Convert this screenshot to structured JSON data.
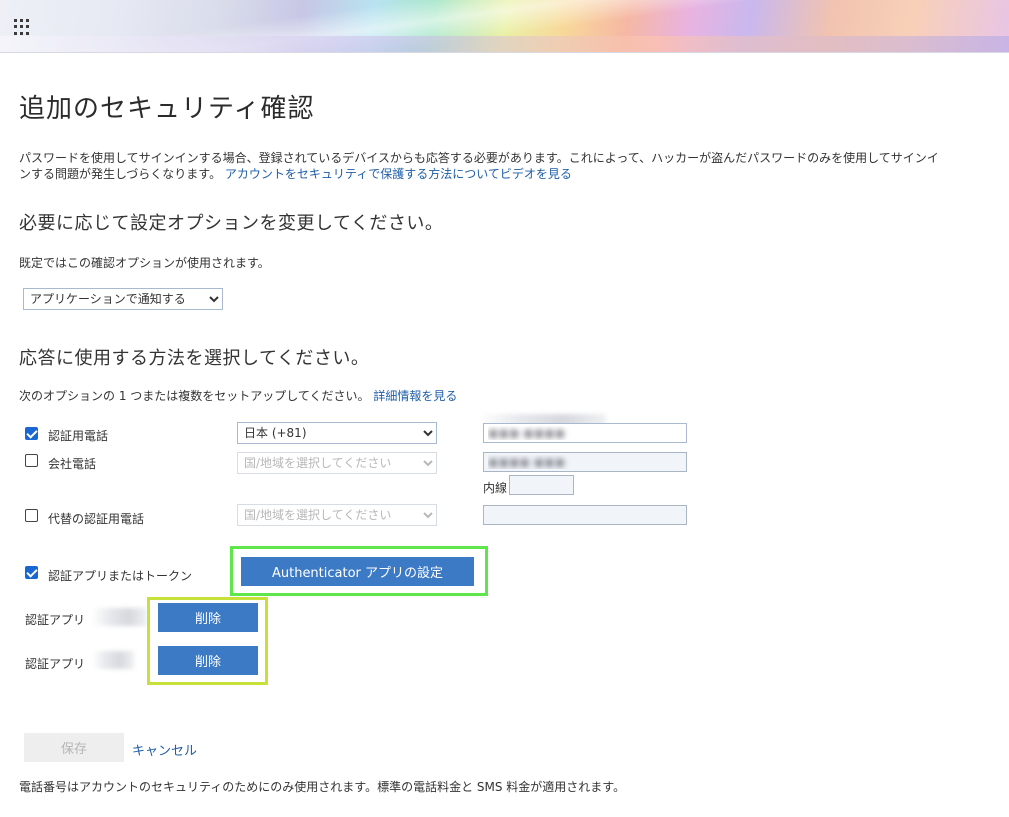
{
  "header": {
    "waffle_icon": "app-launcher-icon"
  },
  "page": {
    "title": "追加のセキュリティ確認",
    "description": "パスワードを使用してサインインする場合、登録されているデバイスからも応答する必要があります。これによって、ハッカーが盗んだパスワードのみを使用してサインインする問題が発生しづらくなります。",
    "video_link": "アカウントをセキュリティで保護する方法についてビデオを見る"
  },
  "default_option": {
    "heading": "必要に応じて設定オプションを変更してください。",
    "label": "既定ではこの確認オプションが使用されます。",
    "selected": "アプリケーションで通知する"
  },
  "methods": {
    "heading": "応答に使用する方法を選択してください。",
    "subtext": "次のオプションの 1 つまたは複数をセットアップしてください。",
    "more_info_link": "詳細情報を見る",
    "auth_phone": {
      "label": "認証用電話",
      "checked": true,
      "country": "日本 (+81)",
      "phone_value": "●●● ●●●●"
    },
    "office_phone": {
      "label": "会社電話",
      "checked": false,
      "country_placeholder": "国/地域を選択してください",
      "phone_value": "●●●● ●●●",
      "extension_label": "内線"
    },
    "alt_phone": {
      "label": "代替の認証用電話",
      "checked": false,
      "country_placeholder": "国/地域を選択してください"
    },
    "auth_app": {
      "label": "認証アプリまたはトークン",
      "checked": true,
      "setup_button": "Authenticator アプリの設定"
    },
    "apps": [
      {
        "label": "認証アプリ",
        "delete_label": "削除"
      },
      {
        "label": "認証アプリ",
        "delete_label": "削除"
      }
    ]
  },
  "actions": {
    "save": "保存",
    "cancel": "キャンセル"
  },
  "footer_note": "電話番号はアカウントのセキュリティのためにのみ使用されます。標準の電話料金と SMS 料金が適用されます。"
}
